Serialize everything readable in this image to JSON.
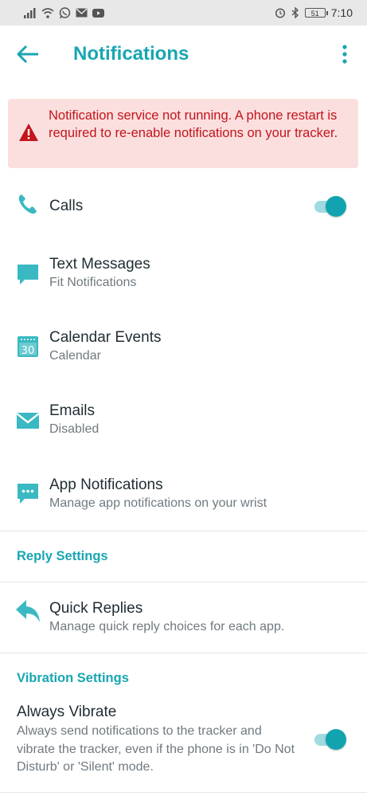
{
  "status_bar": {
    "time": "7:10",
    "battery_level": "51",
    "icons": [
      "signal-icon",
      "wifi-icon",
      "whatsapp-icon",
      "gmail-icon",
      "youtube-icon",
      "alarm-icon",
      "bluetooth-icon",
      "battery-icon"
    ]
  },
  "header": {
    "title": "Notifications",
    "back_icon": "arrow-left-icon",
    "menu_icon": "more-vert-icon"
  },
  "alert": {
    "message": "Notification service not running. A phone restart is required to re-enable notifications on your tracker.",
    "icon": "warning-icon"
  },
  "items": [
    {
      "title": "Calls",
      "subtitle": "",
      "icon": "phone-icon",
      "toggle": true
    },
    {
      "title": "Text Messages",
      "subtitle": "Fit Notifications",
      "icon": "message-icon"
    },
    {
      "title": "Calendar Events",
      "subtitle": "Calendar",
      "icon": "calendar-icon",
      "icon_text": "30"
    },
    {
      "title": "Emails",
      "subtitle": "Disabled",
      "icon": "email-icon"
    },
    {
      "title": "App Notifications",
      "subtitle": "Manage app notifications on your wrist",
      "icon": "chat-icon"
    }
  ],
  "reply_settings": {
    "header": "Reply Settings",
    "quick_replies": {
      "title": "Quick Replies",
      "subtitle": "Manage quick reply choices for each app.",
      "icon": "reply-icon"
    }
  },
  "vibration_settings": {
    "header": "Vibration Settings",
    "always_vibrate": {
      "title": "Always Vibrate",
      "description": "Always send notifications to the tracker and vibrate the tracker, even if the phone is in 'Do Not Disturb' or 'Silent' mode.",
      "toggle": true
    }
  },
  "colors": {
    "accent": "#19a6b2",
    "alert_bg": "#fbdfdf",
    "alert_text": "#c3151b",
    "icon": "#3ab9c2"
  }
}
